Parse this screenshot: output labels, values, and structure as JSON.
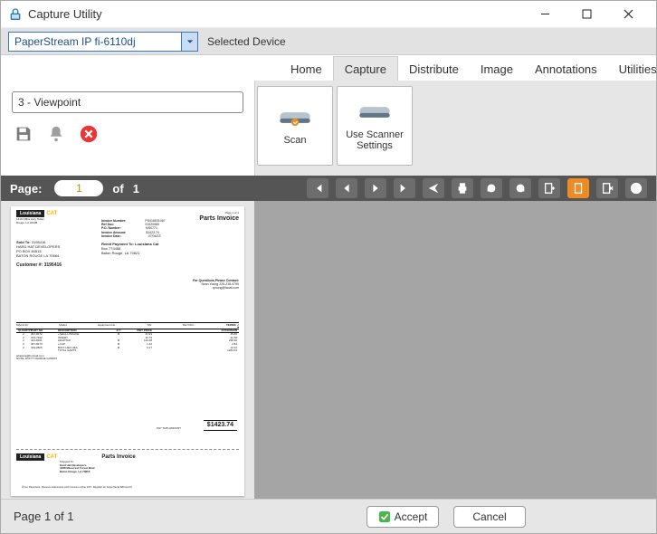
{
  "window": {
    "title": "Capture Utility",
    "lock_icon": "lock-icon"
  },
  "device": {
    "selected": "PaperStream IP fi-6110dj",
    "label": "Selected Device"
  },
  "tabs": [
    "Home",
    "Capture",
    "Distribute",
    "Image",
    "Annotations",
    "Utilities"
  ],
  "active_tab": "Capture",
  "viewpoint": "3 - Viewpoint",
  "left_icons": {
    "save": "save-icon",
    "bell": "bell-icon",
    "cancel": "cancel-icon"
  },
  "ribbon": {
    "scan": "Scan",
    "use_scanner": "Use Scanner Settings"
  },
  "page_toolbar": {
    "label": "Page:",
    "current": "1",
    "of_label": "of",
    "total": "1"
  },
  "status": "Page 1 of 1",
  "buttons": {
    "accept": "Accept",
    "cancel": "Cancel"
  },
  "document": {
    "brand": "Louisiana",
    "brand2": "CAT",
    "page": "Page 1 of 1",
    "title": "Parts Invoice",
    "meta": {
      "invoice_number_label": "Invoice Number:",
      "invoice_number": "PS016531067",
      "ref_doc_label": "Ref Doc:",
      "ref_doc": "91920989",
      "po_label": "P.O. Number:",
      "po": "MS0771",
      "amount_label": "Invoice Amount:",
      "amount": "$1423.74",
      "date_label": "Invoice Date:",
      "date": "07/06/23"
    },
    "soldto_label": "Sold To:",
    "soldto_id": "3195416",
    "soldto_lines": [
      "HARD HAT DEVELOPERS",
      "PO BOX 84515",
      "BATON ROUGE LA 70884"
    ],
    "customer_label": "Customer #:",
    "customer": "3195416",
    "remit_label": "Remit Payment To: Louisiana Cat",
    "remit_lines": [
      "Box 774458",
      "Baton Rouge, LA 70821"
    ],
    "questions_label": "For Questions,Please Contact:",
    "questions_lines": [
      "Sean Young 225-218-4790",
      "ryoung@lacat.com"
    ],
    "terms_label": "TERMS:",
    "terms": "2",
    "columns": [
      "QUANTITY",
      "PART NO",
      "DESCRIPTION",
      "D",
      "UNIT PRICE",
      "EXTENSION"
    ],
    "rows": [
      {
        "qty": "2",
        "part": "367-8472",
        "desc": "+SEAL-LINKAGE",
        "d": "M",
        "price": "22.93",
        "ext": "45.86"
      },
      {
        "qty": "2",
        "part": "333-7492",
        "desc": "INSERT",
        "d": "",
        "price": "15.79",
        "ext": "31.58"
      },
      {
        "qty": "2",
        "part": "443-8361",
        "desc": "ADAPTAO",
        "d": "M",
        "price": "119.48",
        "ext": "238.96"
      },
      {
        "qty": "2",
        "part": "367-8279",
        "desc": "+CUP",
        "d": "M",
        "price": "1.42",
        "ext": "2.84"
      },
      {
        "qty": "2",
        "part": "433-2825",
        "desc": "BOLT-HEX HEA",
        "d": "M",
        "price": "6.17",
        "ext": "12.34"
      },
      {
        "qty": "",
        "part": "",
        "desc": "TOTAL GARTS",
        "d": "",
        "price": "",
        "ext": "1284.63"
      }
    ],
    "notes": [
      "adaware@hotmail.com",
      "NOTE: DON'T CHARGE GJW907"
    ],
    "pay_this_label": "PAY THIS AMOUNT",
    "total": "$1423.74",
    "stub_title": "Parts Invoice",
    "ship_label": "Shipped To:",
    "ship_lines": [
      "Hard Hat Developers",
      "1838 Bluecrest Forest Blvd",
      "Baton Rouge, LA 70816"
    ],
    "footer": "Go Paperless. Receive statements and invoices online 24/7. Register at:   https://lacat.billtrust.biz"
  }
}
